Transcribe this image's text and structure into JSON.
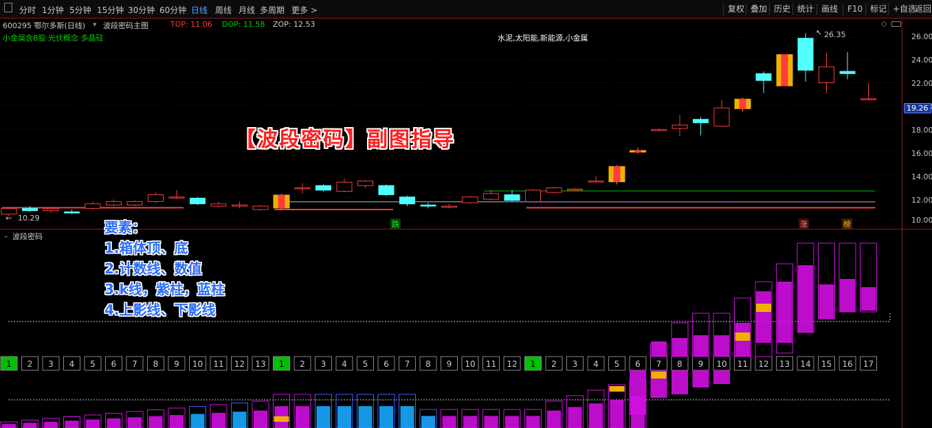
{
  "toolbar": {
    "periods": [
      "分时",
      "1分钟",
      "5分钟",
      "15分钟",
      "30分钟",
      "60分钟",
      "日线",
      "周线",
      "月线",
      "多周期",
      "更多 >"
    ],
    "active_period": "日线",
    "right_buttons": [
      "复权",
      "叠加",
      "历史",
      "统计",
      "画线",
      "F10",
      "标记",
      "+自选",
      "返回"
    ]
  },
  "header": {
    "stock": "600295 鄂尔多斯(日线)",
    "indicator": "波段密码主图",
    "top": "TOP: 11.06",
    "dop": "DOP: 11.58",
    "zop": "ZOP: 12.53",
    "concepts": "小金属含B股 光伏概念 多晶硅",
    "news_concepts": "水泥,太阳能,新能源,小金属"
  },
  "price_axis": {
    "labels": [
      "26.00",
      "24.00",
      "22.00",
      "20.00",
      "18.00",
      "16.00",
      "14.00",
      "12.00",
      "10.00"
    ],
    "current": "19.26",
    "high_marker": "26.35",
    "low_marker": "10.29"
  },
  "markers": {
    "die": "跌",
    "zhang": "涨",
    "bang": "榜"
  },
  "title_overlay": "【波段密码】副图指导",
  "sub_panel": {
    "title": "波段密码"
  },
  "elements_note": {
    "heading": "要素：",
    "items": [
      "1.箱体顶、底",
      "2.计数线、数值",
      "3.k线，紫柱，蓝柱",
      "4.上影线、下影线"
    ]
  },
  "colors": {
    "up": "#ff3c3c",
    "down": "#50ffff",
    "purple": "#d010e0",
    "blue": "#18a8ff",
    "gold": "#f0b000",
    "green": "#00c000"
  },
  "chart_data": {
    "type": "candlestick",
    "ylim": [
      9.8,
      26.6
    ],
    "candles": [
      {
        "o": 10.5,
        "c": 11.0,
        "h": 11.1,
        "l": 10.3
      },
      {
        "o": 11.0,
        "c": 10.8,
        "h": 11.2,
        "l": 10.7
      },
      {
        "o": 10.8,
        "c": 11.0,
        "h": 11.1,
        "l": 10.6
      },
      {
        "o": 10.7,
        "c": 10.6,
        "h": 10.9,
        "l": 10.5
      },
      {
        "o": 11.0,
        "c": 11.4,
        "h": 11.6,
        "l": 10.9
      },
      {
        "o": 11.3,
        "c": 11.6,
        "h": 11.8,
        "l": 11.2
      },
      {
        "o": 11.3,
        "c": 11.6,
        "h": 11.7,
        "l": 11.2
      },
      {
        "o": 11.6,
        "c": 12.2,
        "h": 12.4,
        "l": 11.5
      },
      {
        "o": 12.0,
        "c": 12.0,
        "h": 12.6,
        "l": 11.8
      },
      {
        "o": 11.9,
        "c": 11.4,
        "h": 12.0,
        "l": 11.3
      },
      {
        "o": 11.2,
        "c": 11.4,
        "h": 11.6,
        "l": 11.1
      },
      {
        "o": 11.2,
        "c": 11.3,
        "h": 11.6,
        "l": 11.0
      },
      {
        "o": 10.9,
        "c": 11.2,
        "h": 11.3,
        "l": 10.8
      },
      {
        "o": 11.0,
        "c": 12.2,
        "h": 12.3,
        "l": 10.9
      },
      {
        "o": 12.8,
        "c": 12.8,
        "h": 13.2,
        "l": 12.3
      },
      {
        "o": 13.0,
        "c": 12.6,
        "h": 13.1,
        "l": 12.5
      },
      {
        "o": 12.5,
        "c": 13.3,
        "h": 13.6,
        "l": 12.4
      },
      {
        "o": 13.0,
        "c": 13.4,
        "h": 13.5,
        "l": 12.8
      },
      {
        "o": 13.0,
        "c": 12.2,
        "h": 13.1,
        "l": 12.1
      },
      {
        "o": 12.0,
        "c": 11.4,
        "h": 12.1,
        "l": 11.2
      },
      {
        "o": 11.3,
        "c": 11.2,
        "h": 11.5,
        "l": 11.0
      },
      {
        "o": 11.2,
        "c": 11.2,
        "h": 11.4,
        "l": 11.0
      },
      {
        "o": 11.5,
        "c": 12.0,
        "h": 12.1,
        "l": 11.4
      },
      {
        "o": 11.8,
        "c": 12.3,
        "h": 12.6,
        "l": 11.7
      },
      {
        "o": 12.2,
        "c": 11.7,
        "h": 12.6,
        "l": 11.6
      },
      {
        "o": 11.6,
        "c": 12.6,
        "h": 12.7,
        "l": 11.6
      },
      {
        "o": 12.4,
        "c": 12.8,
        "h": 12.9,
        "l": 12.3
      },
      {
        "o": 12.6,
        "c": 12.7,
        "h": 12.8,
        "l": 12.5
      },
      {
        "o": 13.4,
        "c": 13.4,
        "h": 13.8,
        "l": 13.2
      },
      {
        "o": 13.3,
        "c": 14.7,
        "h": 14.8,
        "l": 13.1
      },
      {
        "o": 15.9,
        "c": 16.1,
        "h": 16.3,
        "l": 15.8
      },
      {
        "o": 17.9,
        "c": 17.9,
        "h": 18.0,
        "l": 17.9
      },
      {
        "o": 18.0,
        "c": 18.3,
        "h": 19.2,
        "l": 17.3
      },
      {
        "o": 18.8,
        "c": 18.5,
        "h": 19.0,
        "l": 17.4
      },
      {
        "o": 18.2,
        "c": 19.8,
        "h": 20.5,
        "l": 18.2
      },
      {
        "o": 19.7,
        "c": 20.6,
        "h": 20.7,
        "l": 19.5
      },
      {
        "o": 22.8,
        "c": 22.2,
        "h": 23.0,
        "l": 21.1
      },
      {
        "o": 21.7,
        "c": 24.5,
        "h": 24.5,
        "l": 21.7
      },
      {
        "o": 25.9,
        "c": 23.1,
        "h": 26.35,
        "l": 22.1
      },
      {
        "o": 22.0,
        "c": 23.4,
        "h": 24.6,
        "l": 21.1
      },
      {
        "o": 23.0,
        "c": 22.8,
        "h": 24.7,
        "l": 22.3
      },
      {
        "o": 20.6,
        "c": 20.6,
        "h": 22.0,
        "l": 20.5
      }
    ],
    "highlight_candles": [
      13,
      29,
      30,
      35,
      37
    ],
    "lines": {
      "green": {
        "value": 12.53,
        "from": 23,
        "to": 41
      },
      "white": {
        "value": 11.58,
        "from": 13,
        "to": 41
      },
      "purple": {
        "value": 11.58,
        "from": 24,
        "to": 41
      },
      "red_a": {
        "value": 11.06,
        "from": 0,
        "to": 8
      },
      "red_b": {
        "value": 10.9,
        "from": 13,
        "to": 18
      },
      "red_c": {
        "value": 11.06,
        "from": 25,
        "to": 41
      }
    },
    "counts": [
      "1",
      "2",
      "3",
      "4",
      "5",
      "6",
      "7",
      "8",
      "9",
      "10",
      "11",
      "12",
      "13",
      "1",
      "2",
      "3",
      "4",
      "5",
      "6",
      "7",
      "8",
      "9",
      "10",
      "11",
      "12",
      "1",
      "2",
      "3",
      "4",
      "5",
      "6",
      "7",
      "8",
      "9",
      "10",
      "11",
      "12",
      "13",
      "14",
      "15",
      "16",
      "17"
    ],
    "counter_green_cells": [
      0,
      13,
      25
    ]
  }
}
